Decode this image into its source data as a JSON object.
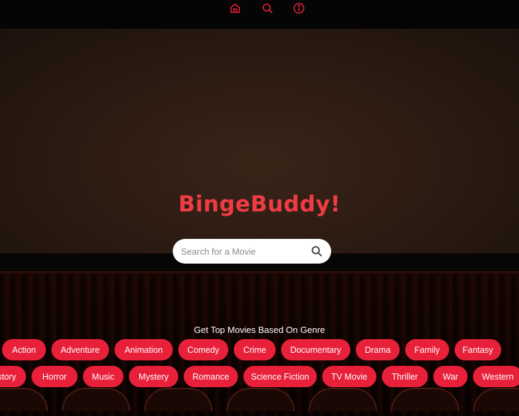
{
  "nav": {
    "home_icon": "home-icon",
    "search_icon": "search-icon",
    "info_icon": "info-icon",
    "accent": "#e9203a"
  },
  "hero": {
    "title": "BingeBuddy!",
    "title_color": "#ef3b44"
  },
  "search": {
    "placeholder": "Search for a Movie",
    "value": "",
    "icon": "search-icon"
  },
  "genres": {
    "heading": "Get Top Movies Based On Genre",
    "chip_color": "#e9203a",
    "row1": [
      "Action",
      "Adventure",
      "Animation",
      "Comedy",
      "Crime",
      "Documentary",
      "Drama",
      "Family",
      "Fantasy"
    ],
    "row2": [
      "History",
      "Horror",
      "Music",
      "Mystery",
      "Romance",
      "Science Fiction",
      "TV Movie",
      "Thriller",
      "War",
      "Western"
    ]
  }
}
